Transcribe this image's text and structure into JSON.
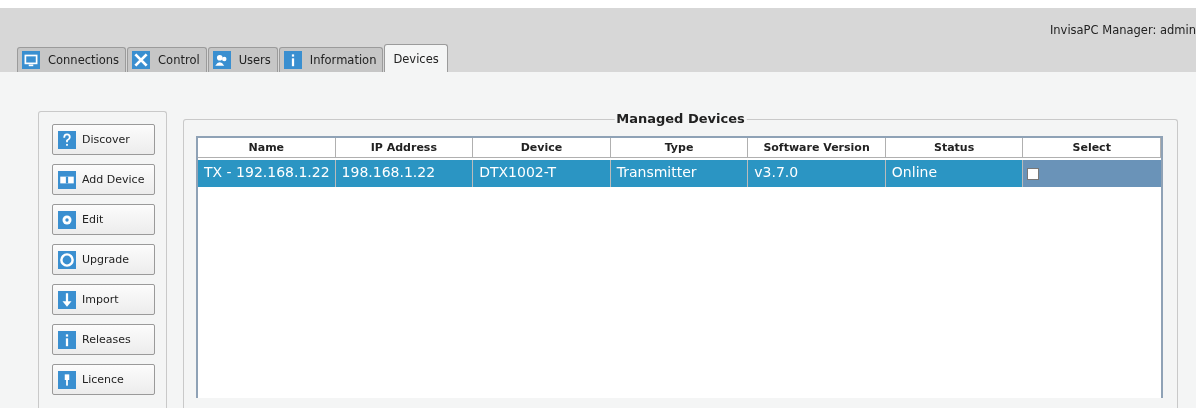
{
  "header": {
    "title": "InvisaPC Manager:  admin"
  },
  "tabs": [
    {
      "label": "Connections",
      "selected": false
    },
    {
      "label": "Control",
      "selected": false
    },
    {
      "label": "Users",
      "selected": false
    },
    {
      "label": "Information",
      "selected": false
    },
    {
      "label": "Devices",
      "selected": true
    }
  ],
  "actions": [
    {
      "label": "Discover"
    },
    {
      "label": "Add Device"
    },
    {
      "label": "Edit"
    },
    {
      "label": "Upgrade"
    },
    {
      "label": "Import"
    },
    {
      "label": "Releases"
    },
    {
      "label": "Licence"
    }
  ],
  "devices": {
    "title": "Managed Devices",
    "table": {
      "columns": [
        "Name",
        "IP Address",
        "Device",
        "Type",
        "Software Version",
        "Status",
        "Select"
      ],
      "rows": [
        {
          "selected": true,
          "checked": false,
          "cells": [
            "TX - 192.168.1.22",
            "198.168.1.22",
            "DTX1002-T",
            "Transmitter",
            "v3.7.0",
            "Online"
          ]
        }
      ]
    }
  }
}
